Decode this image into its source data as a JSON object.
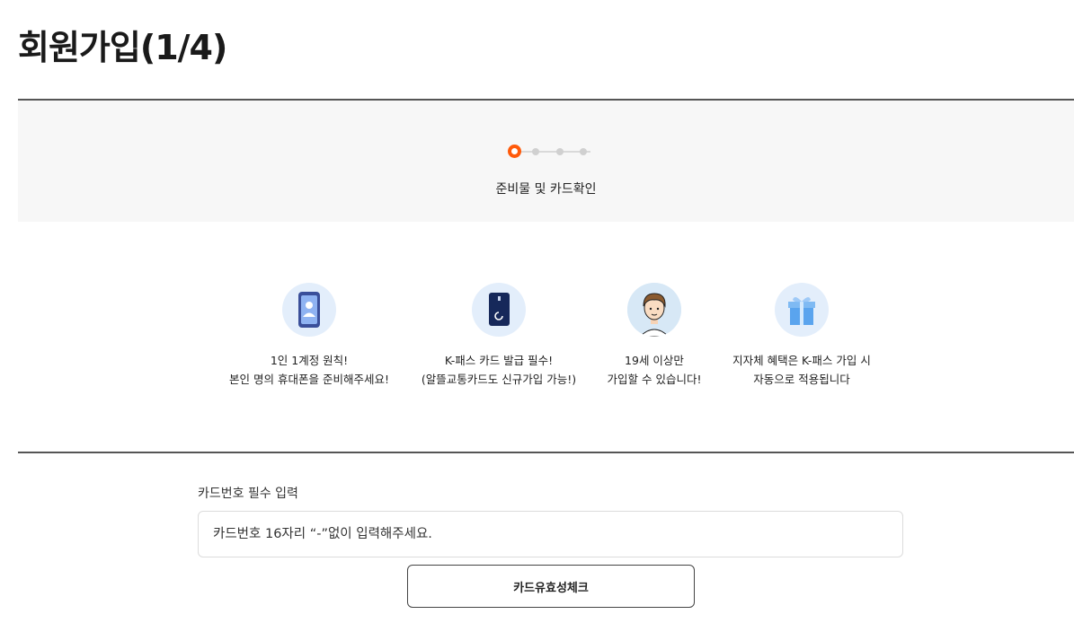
{
  "page": {
    "title": "회원가입(1/4)"
  },
  "stepper": {
    "current_step": 1,
    "total_steps": 4,
    "label": "준비물 및 카드확인",
    "accent_color": "#ff5a0a"
  },
  "features": [
    {
      "icon": "smartphone-user-icon",
      "line1": "1인 1계정 원칙!",
      "line2": "본인 명의 휴대폰을 준비해주세요!"
    },
    {
      "icon": "kpass-card-icon",
      "line1": "K-패스 카드 발급 필수!",
      "line2": "(알뜰교통카드도 신규가입 가능!)"
    },
    {
      "icon": "person-avatar-icon",
      "line1": "19세 이상만",
      "line2": "가입할 수 있습니다!"
    },
    {
      "icon": "gift-box-icon",
      "line1": "지자체 혜택은 K-패스 가입 시",
      "line2": "자동으로 적용됩니다"
    }
  ],
  "card_form": {
    "label": "카드번호 필수 입력",
    "placeholder": "카드번호 16자리 “-”없이 입력해주세요.",
    "value": "",
    "check_button_label": "카드유효성체크"
  }
}
